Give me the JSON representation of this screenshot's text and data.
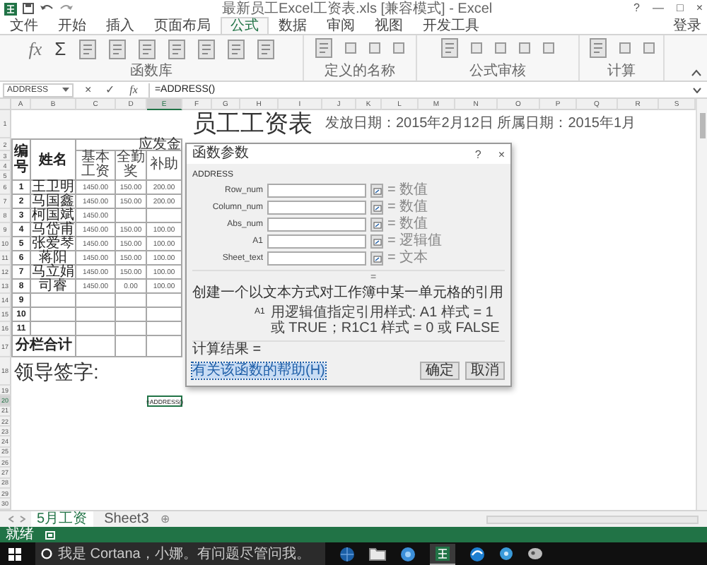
{
  "title_bar": {
    "title": "最新员工Excel工资表.xls [兼容模式] - Excel",
    "controls": [
      "?",
      "—",
      "□",
      "×"
    ]
  },
  "tabs": [
    {
      "label": "文件",
      "selected": false
    },
    {
      "label": "开始",
      "selected": false
    },
    {
      "label": "插入",
      "selected": false
    },
    {
      "label": "页面布局",
      "selected": false
    },
    {
      "label": "公式",
      "selected": true
    },
    {
      "label": "数据",
      "selected": false
    },
    {
      "label": "审阅",
      "selected": false
    },
    {
      "label": "视图",
      "selected": false
    },
    {
      "label": "开发工具",
      "selected": false
    }
  ],
  "sign_in": "登录",
  "ribbon": {
    "glyphs": [
      "fx",
      "Σ"
    ],
    "groups": [
      {
        "label": "函数库"
      },
      {
        "label": "定义的名称"
      },
      {
        "label": "公式审核"
      },
      {
        "label": "计算"
      }
    ]
  },
  "formula_bar": {
    "name_box": "ADDRESS",
    "buttons": [
      "×",
      "✓",
      "fx"
    ],
    "formula": "=ADDRESS()"
  },
  "columns": [
    {
      "label": "A",
      "selected": false
    },
    {
      "label": "B",
      "selected": false
    },
    {
      "label": "C",
      "selected": false
    },
    {
      "label": "D",
      "selected": false
    },
    {
      "label": "E",
      "selected": true
    },
    {
      "label": "F",
      "selected": false
    },
    {
      "label": "G",
      "selected": false
    },
    {
      "label": "H",
      "selected": false
    },
    {
      "label": "I",
      "selected": false
    },
    {
      "label": "J",
      "selected": false
    },
    {
      "label": "K",
      "selected": false
    },
    {
      "label": "L",
      "selected": false
    },
    {
      "label": "M",
      "selected": false
    },
    {
      "label": "N",
      "selected": false
    },
    {
      "label": "O",
      "selected": false
    },
    {
      "label": "P",
      "selected": false
    },
    {
      "label": "Q",
      "selected": false
    },
    {
      "label": "R",
      "selected": false
    },
    {
      "label": "S",
      "selected": false
    }
  ],
  "rows": [
    {
      "label": "1",
      "selected": false
    },
    {
      "label": "2",
      "selected": false
    },
    {
      "label": "3",
      "selected": false
    },
    {
      "label": "4",
      "selected": false
    },
    {
      "label": "5",
      "selected": false
    },
    {
      "label": "6",
      "selected": false
    },
    {
      "label": "7",
      "selected": false
    },
    {
      "label": "8",
      "selected": false
    },
    {
      "label": "9",
      "selected": false
    },
    {
      "label": "10",
      "selected": false
    },
    {
      "label": "11",
      "selected": false
    },
    {
      "label": "12",
      "selected": false
    },
    {
      "label": "13",
      "selected": false
    },
    {
      "label": "14",
      "selected": false
    },
    {
      "label": "15",
      "selected": false
    },
    {
      "label": "16",
      "selected": false
    },
    {
      "label": "17",
      "selected": false
    },
    {
      "label": "18",
      "selected": false
    },
    {
      "label": "19",
      "selected": false
    },
    {
      "label": "20",
      "selected": true
    },
    {
      "label": "21",
      "selected": false
    },
    {
      "label": "22",
      "selected": false
    },
    {
      "label": "23",
      "selected": false
    },
    {
      "label": "24",
      "selected": false
    },
    {
      "label": "25",
      "selected": false
    },
    {
      "label": "26",
      "selected": false
    },
    {
      "label": "27",
      "selected": false
    },
    {
      "label": "28",
      "selected": false
    },
    {
      "label": "29",
      "selected": false
    },
    {
      "label": "30",
      "selected": false
    }
  ],
  "sheet": {
    "title": "员工工资表",
    "dates": "发放日期：2015年2月12日 所属日期：2015年1月",
    "table": {
      "group_header": "应发金",
      "headers": [
        "编号",
        "姓名",
        "基本工资",
        "全勤奖",
        "补助"
      ],
      "rows": [
        {
          "no": "1",
          "name": "王卫明",
          "values": [
            "1450.00",
            "150.00",
            "200.00"
          ]
        },
        {
          "no": "2",
          "name": "马国鑫",
          "values": [
            "1450.00",
            "150.00",
            "200.00"
          ]
        },
        {
          "no": "3",
          "name": "柯国斌",
          "values": [
            "1450.00"
          ]
        },
        {
          "no": "4",
          "name": "马岱甫",
          "values": [
            "1450.00",
            "150.00",
            "100.00"
          ]
        },
        {
          "no": "5",
          "name": "张爱琴",
          "values": [
            "1450.00",
            "150.00",
            "100.00"
          ]
        },
        {
          "no": "6",
          "name": "蒋阳",
          "values": [
            "1450.00",
            "150.00",
            "100.00"
          ]
        },
        {
          "no": "7",
          "name": "马立娟",
          "values": [
            "1450.00",
            "150.00",
            "100.00"
          ]
        },
        {
          "no": "8",
          "name": "司睿",
          "values": [
            "1450.00",
            "0.00",
            "100.00"
          ]
        },
        {
          "no": "9"
        },
        {
          "no": "10"
        },
        {
          "no": "11"
        }
      ],
      "subtotal_label": "分栏合计"
    },
    "signature_label": "领导签字:",
    "active_cell": "=ADDRESS()"
  },
  "dialog": {
    "title": "函数参数",
    "controls": [
      "?",
      "×"
    ],
    "function": "ADDRESS",
    "args": [
      {
        "name": "Row_num",
        "hint": "= 数值"
      },
      {
        "name": "Column_num",
        "hint": "= 数值"
      },
      {
        "name": "Abs_num",
        "hint": "= 数值"
      },
      {
        "name": "A1",
        "hint": "= 逻辑值"
      },
      {
        "name": "Sheet_text",
        "hint": "= 文本"
      }
    ],
    "result_eq": "=",
    "description": "创建一个以文本方式对工作簿中某一单元格的引用",
    "arg_help": {
      "name": "A1",
      "text": "用逻辑值指定引用样式: A1 样式 = 1 或 TRUE；R1C1 样式 = 0 或 FALSE"
    },
    "result_label": "计算结果 =",
    "help_link": {
      "label": "有关该函数的帮助(H)",
      "focused": true
    },
    "buttons": [
      "确定",
      "取消"
    ]
  },
  "sheet_tabs": [
    {
      "label": "5月工资",
      "selected": true
    },
    {
      "label": "Sheet3",
      "selected": false
    }
  ],
  "add_sheet": "⊕",
  "status_bar": {
    "text": "就绪"
  },
  "taskbar": {
    "search_placeholder": "我是 Cortana，小娜。有问题尽管问我。"
  }
}
